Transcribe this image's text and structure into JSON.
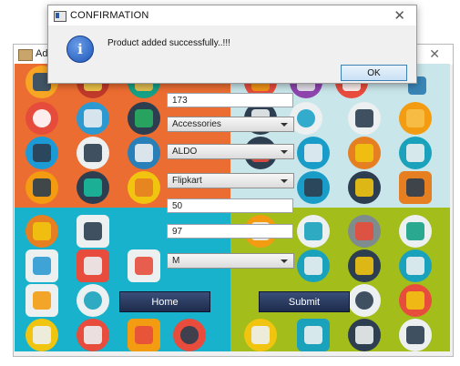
{
  "dialog": {
    "title": "CONFIRMATION",
    "close_symbol": "✕",
    "message": "Product added successfully..!!!",
    "ok_label": "OK",
    "icon": "info-icon"
  },
  "background_window": {
    "title": "Ad",
    "close_symbol": "✕"
  },
  "form": {
    "product_id": "173",
    "category": "Accessories",
    "brand": "ALDO",
    "seller": "Flipkart",
    "quantity": "50",
    "price": "97",
    "size": "M"
  },
  "buttons": {
    "home_label": "Home",
    "submit_label": "Submit"
  },
  "colors": {
    "orange": "#ec6d31",
    "light_blue": "#c9e6ea",
    "teal": "#19b2cc",
    "lime": "#a3bd1b",
    "button_navy": "#1e2c4d"
  }
}
